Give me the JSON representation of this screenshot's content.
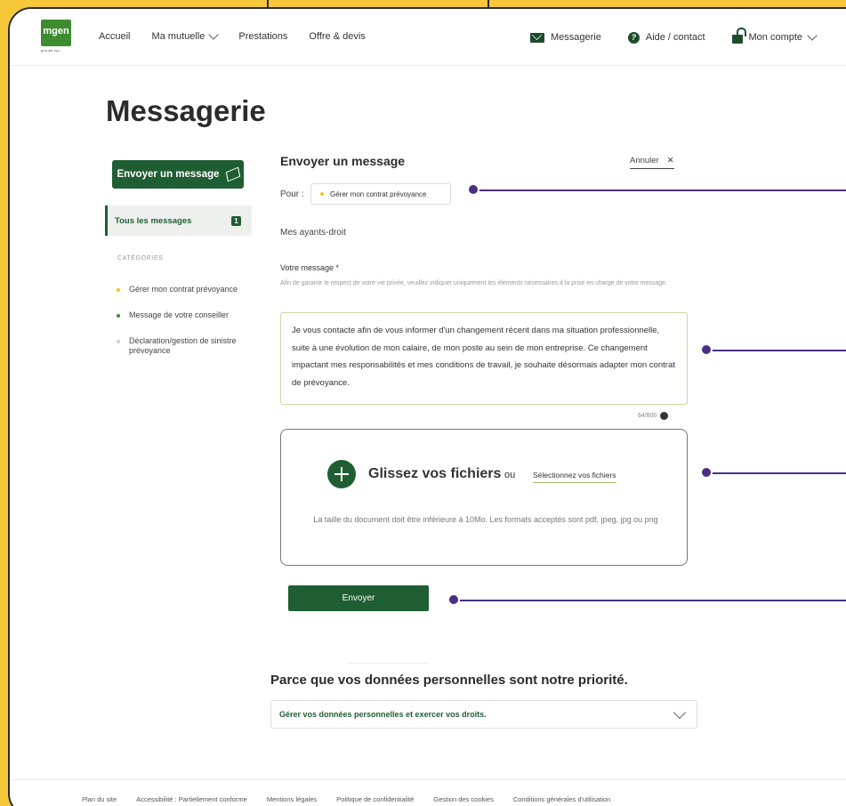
{
  "nav": {
    "logo": "mgen",
    "logo_sub": "groupe vyv",
    "left": [
      "Accueil",
      "Ma mutuelle",
      "Prestations",
      "Offre & devis"
    ],
    "right": [
      "Messagerie",
      "Aide / contact",
      "Mon compte"
    ]
  },
  "page_title": "Messagerie",
  "sidebar": {
    "new_message_label": "Envoyer un message",
    "all_messages_label": "Tous les messages",
    "all_messages_count": "1",
    "categories_title": "CATÉGORIES",
    "categories": [
      {
        "label": "Gérer mon contrat prévoyance",
        "color": "#f0c419"
      },
      {
        "label": "Message de votre conseiller",
        "color": "#3d8c2f"
      },
      {
        "label": "Déclaration/gestion de sinistre prévoyance",
        "color": "#cfcfcf"
      }
    ]
  },
  "form": {
    "title": "Envoyer un message",
    "cancel_label": "Annuler",
    "to_label": "Pour :",
    "to_chip": "Gérer mon contrat prévoyance",
    "beneficiaries": "Mes ayants-droit",
    "message_label": "Votre message *",
    "message_note": "Afin de garantir le respect de votre vie privée, veuillez indiquer uniquement les éléments nécessaires à la prise en charge de votre message.",
    "message_value": "Je vous contacte afin de vous informer d'un changement récent dans ma situation professionnelle, suite à une évolution de mon calaire, de mon poste au sein de mon entreprise. Ce changement impactant mes responsabilités et mes conditions de travail, je souhaite désormais adapter mon contrat de prévoyance.",
    "char_count": "64/800",
    "drop_title": "Glissez vos fichiers",
    "drop_or": "ou",
    "drop_select": "Sélectionnez vos fichiers",
    "drop_note": "La taille du document doit être inférieure à 10Mo. Les formats acceptés sont pdf, jpeg, jpg ou png",
    "send_label": "Envoyer"
  },
  "privacy": {
    "title": "Parce que vos données personnelles sont notre priorité.",
    "accordion_label": "Gérer vos données personnelles et exercer vos droits."
  },
  "footer": {
    "links": [
      "Plan du site",
      "Accessibilité : Partiellement conforme",
      "Mentions légales",
      "Politique de confidentialité",
      "Gestion des cookies",
      "Conditions générales d'utilisation"
    ]
  },
  "colors": {
    "brand_green": "#1f5e33",
    "background_yellow": "#f7c93a",
    "annotation_purple": "#4a2f82"
  }
}
